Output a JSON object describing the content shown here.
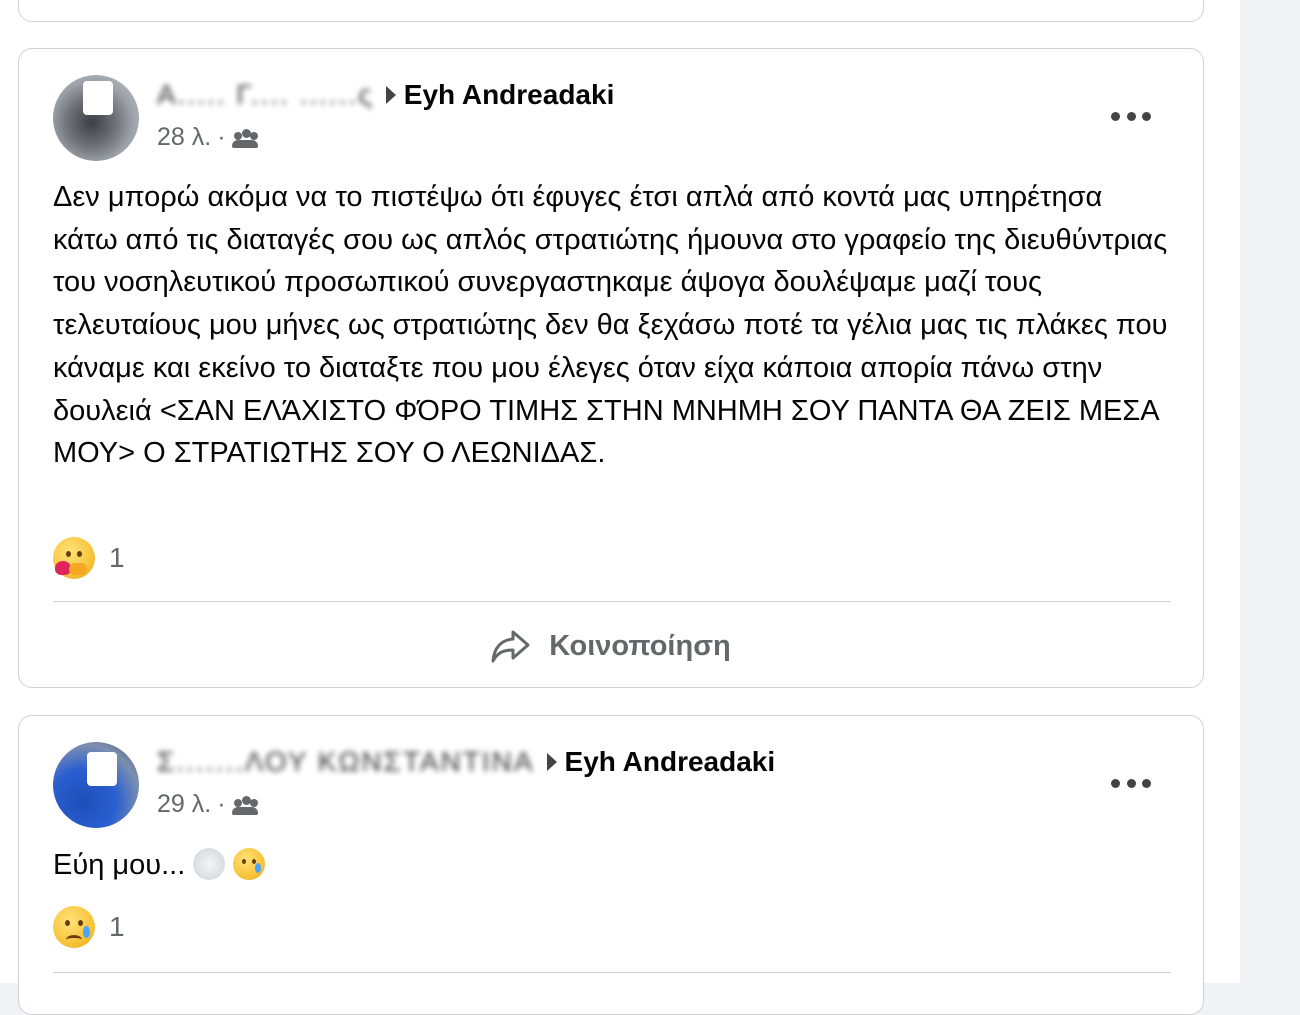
{
  "posts": [
    {
      "author_hidden": "Α..... Γ.... ......ς",
      "group": "Eyh Andreadaki",
      "time": "28 λ.",
      "separator": "·",
      "audience_icon": "friends-icon",
      "text": "Δεν μπορώ ακόμα να το πιστέψω ότι έφυγες έτσι απλά από κοντά μας υπηρέτησα κάτω από τις διαταγές σου ως απλός στρατιώτης ήμουνα στο γραφείο της διευθύντριας του νοσηλευτικού προσωπικού συνεργαστηκαμε άψογα δουλέψαμε μαζί τους τελευταίους μου μήνες ως στρατιώτης δεν θα ξεχάσω ποτέ τα γέλια μας τις πλάκες που κάναμε και εκείνο το διαταξτε που μου έλεγες όταν είχα κάποια απορία πάνω στην δουλειά <ΣΑΝ ΕΛΆΧΙΣΤΟ ΦΌΡΟ ΤΙΜΗΣ ΣΤΗΝ ΜΝΗΜΗ ΣΟΥ ΠΑΝΤΑ ΘΑ ΖΕΙΣ ΜΕΣΑ ΜΟΥ> Ο ΣΤΡΑΤΙΩΤΗΣ ΣΟΥ Ο ΛΕΩΝΙΔΑΣ.",
      "reaction_icon": "care-reaction-icon",
      "reaction_count": "1",
      "share_label": "Κοινοποίηση"
    },
    {
      "author_hidden": "Σ.......ΛΟΥ ΚΩΝΣΤΑΝΤΙΝΑ",
      "group": "Eyh Andreadaki",
      "time": "29 λ.",
      "separator": "·",
      "audience_icon": "friends-icon",
      "text": "Εύη μου...",
      "inline_emojis": [
        "dove-icon",
        "sad-tear-icon"
      ],
      "reaction_icon": "sad-reaction-icon",
      "reaction_count": "1"
    }
  ]
}
